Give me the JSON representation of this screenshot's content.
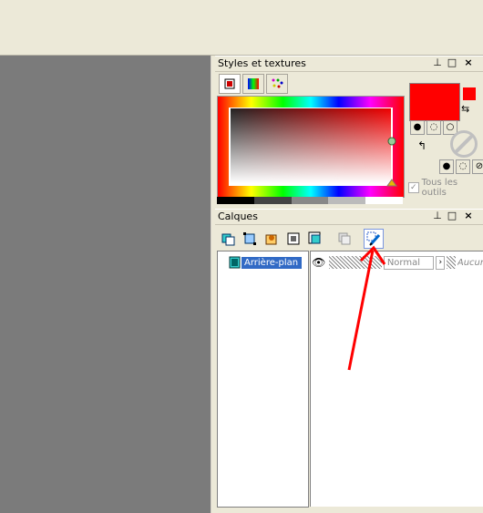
{
  "styles_panel": {
    "title": "Styles et textures",
    "all_tools_label": "Tous les outils",
    "foreground_color": "#ff0000",
    "tabs": [
      "color-picker-tab",
      "gradient-tab",
      "pattern-tab"
    ]
  },
  "layers_panel": {
    "title": "Calques",
    "layers": [
      {
        "name": "Arrière-plan",
        "blend_mode": "Normal",
        "lock": "Aucun"
      }
    ]
  },
  "title_buttons": {
    "pin": "⊥",
    "maximize": "□",
    "close": "×"
  },
  "annotation": {
    "color": "#ff0000",
    "target": "layer-properties-button"
  }
}
